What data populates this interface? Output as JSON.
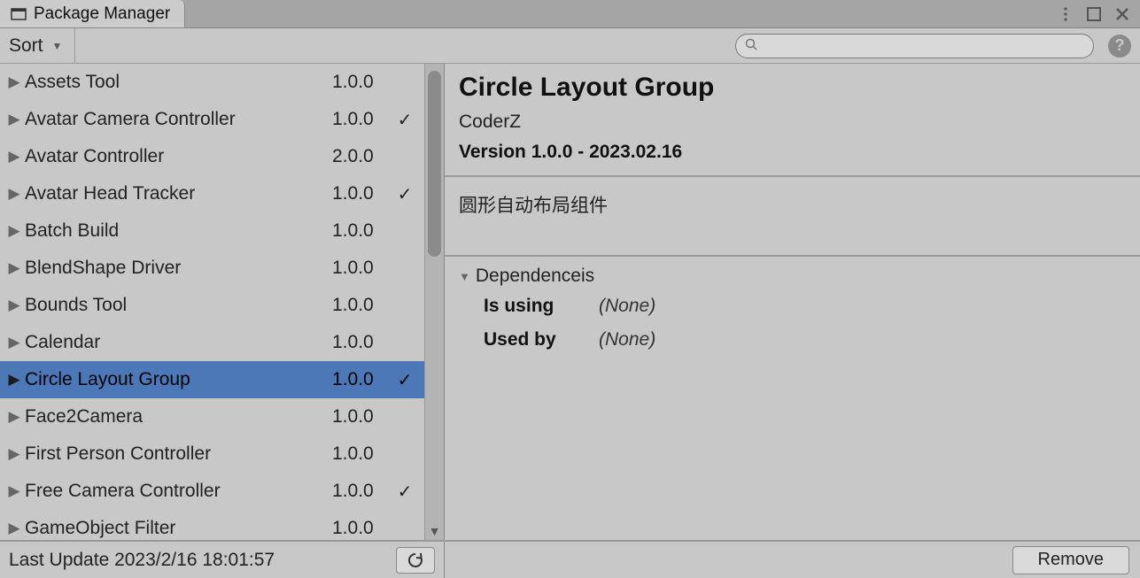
{
  "window": {
    "title": "Package Manager"
  },
  "toolbar": {
    "sort_label": "Sort",
    "search_placeholder": "",
    "help_symbol": "?"
  },
  "packages": [
    {
      "name": "Assets Tool",
      "version": "1.0.0",
      "installed": false,
      "selected": false
    },
    {
      "name": "Avatar Camera Controller",
      "version": "1.0.0",
      "installed": true,
      "selected": false
    },
    {
      "name": "Avatar Controller",
      "version": "2.0.0",
      "installed": false,
      "selected": false
    },
    {
      "name": "Avatar Head Tracker",
      "version": "1.0.0",
      "installed": true,
      "selected": false
    },
    {
      "name": "Batch Build",
      "version": "1.0.0",
      "installed": false,
      "selected": false
    },
    {
      "name": "BlendShape Driver",
      "version": "1.0.0",
      "installed": false,
      "selected": false
    },
    {
      "name": "Bounds Tool",
      "version": "1.0.0",
      "installed": false,
      "selected": false
    },
    {
      "name": "Calendar",
      "version": "1.0.0",
      "installed": false,
      "selected": false
    },
    {
      "name": "Circle Layout Group",
      "version": "1.0.0",
      "installed": true,
      "selected": true
    },
    {
      "name": "Face2Camera",
      "version": "1.0.0",
      "installed": false,
      "selected": false
    },
    {
      "name": "First Person Controller",
      "version": "1.0.0",
      "installed": false,
      "selected": false
    },
    {
      "name": "Free Camera Controller",
      "version": "1.0.0",
      "installed": true,
      "selected": false
    },
    {
      "name": "GameObject Filter",
      "version": "1.0.0",
      "installed": false,
      "selected": false
    }
  ],
  "detail": {
    "title": "Circle Layout Group",
    "author": "CoderZ",
    "version_line": "Version 1.0.0 - 2023.02.16",
    "description": "圆形自动布局组件",
    "dependencies_label": "Dependenceis",
    "is_using_label": "Is using",
    "is_using_value": "(None)",
    "used_by_label": "Used by",
    "used_by_value": "(None)"
  },
  "footer": {
    "last_update": "Last Update 2023/2/16 18:01:57",
    "remove_label": "Remove"
  },
  "glyphs": {
    "check": "✓",
    "triangle_down": "▼",
    "triangle_right": "▶"
  }
}
